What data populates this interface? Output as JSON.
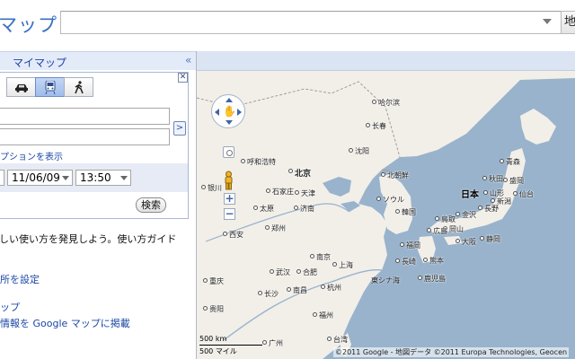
{
  "header": {
    "logo_text": "マップ",
    "search_value": "",
    "search_button": "地"
  },
  "panel": {
    "title": "マイマップ",
    "collapse_symbol": "«",
    "close_symbol": "✕",
    "modes": [
      "car-icon",
      "transit-icon",
      "walk-icon"
    ],
    "origin_value": "",
    "destination_value": "",
    "swap_symbol": ">",
    "options_link": "プションを表示",
    "date_value": "11/06/09",
    "time_value": "13:50",
    "search_button": "検索",
    "promo_text": "しい使い方を発見しよう。使い方ガイド",
    "link_set_location": "所を設定",
    "link_mymap": "ップ",
    "link_publish": "情報を Google マップに掲載"
  },
  "map": {
    "cities": [
      {
        "name": "哈尔滨",
        "big": false
      },
      {
        "name": "长春",
        "big": false
      },
      {
        "name": "沈阳",
        "big": false
      },
      {
        "name": "呼和浩特",
        "big": false
      },
      {
        "name": "北京",
        "big": true
      },
      {
        "name": "天津",
        "big": false
      },
      {
        "name": "石家庄",
        "big": false
      },
      {
        "name": "太原",
        "big": false
      },
      {
        "name": "济南",
        "big": false
      },
      {
        "name": "银川",
        "big": false
      },
      {
        "name": "郑州",
        "big": false
      },
      {
        "name": "西安",
        "big": false
      },
      {
        "name": "南京",
        "big": false
      },
      {
        "name": "上海",
        "big": false
      },
      {
        "name": "合肥",
        "big": false
      },
      {
        "name": "武汉",
        "big": false
      },
      {
        "name": "杭州",
        "big": false
      },
      {
        "name": "重庆",
        "big": false
      },
      {
        "name": "长沙",
        "big": false
      },
      {
        "name": "南昌",
        "big": false
      },
      {
        "name": "贵阳",
        "big": false
      },
      {
        "name": "福州",
        "big": false
      },
      {
        "name": "台湾",
        "big": false
      },
      {
        "name": "北朝鮮",
        "big": false
      },
      {
        "name": "韓国",
        "big": false
      },
      {
        "name": "ソウル",
        "big": false
      },
      {
        "name": "日本",
        "big": true
      },
      {
        "name": "青森",
        "big": false
      },
      {
        "name": "秋田",
        "big": false
      },
      {
        "name": "盛岡",
        "big": false
      },
      {
        "name": "山形",
        "big": false
      },
      {
        "name": "仙台",
        "big": false
      },
      {
        "name": "新潟",
        "big": false
      },
      {
        "name": "金沢",
        "big": false
      },
      {
        "name": "長野",
        "big": false
      },
      {
        "name": "鳥取",
        "big": false
      },
      {
        "name": "岡山",
        "big": false
      },
      {
        "name": "広島",
        "big": false
      },
      {
        "name": "福岡",
        "big": false
      },
      {
        "name": "長崎",
        "big": false
      },
      {
        "name": "熊本",
        "big": false
      },
      {
        "name": "大阪",
        "big": false
      },
      {
        "name": "静岡",
        "big": false
      },
      {
        "name": "鹿児島",
        "big": false
      },
      {
        "name": "東シナ海",
        "big": false
      },
      {
        "name": "广州",
        "big": false
      }
    ],
    "scale_km": "500 km",
    "scale_mi": "500 マイル",
    "copyright": "©2011 Google - 地図データ ©2011 Europa Technologies, Geocen"
  },
  "colors": {
    "land": "#f2efe9",
    "water": "#99b3cc",
    "accent": "#1b47a6"
  }
}
